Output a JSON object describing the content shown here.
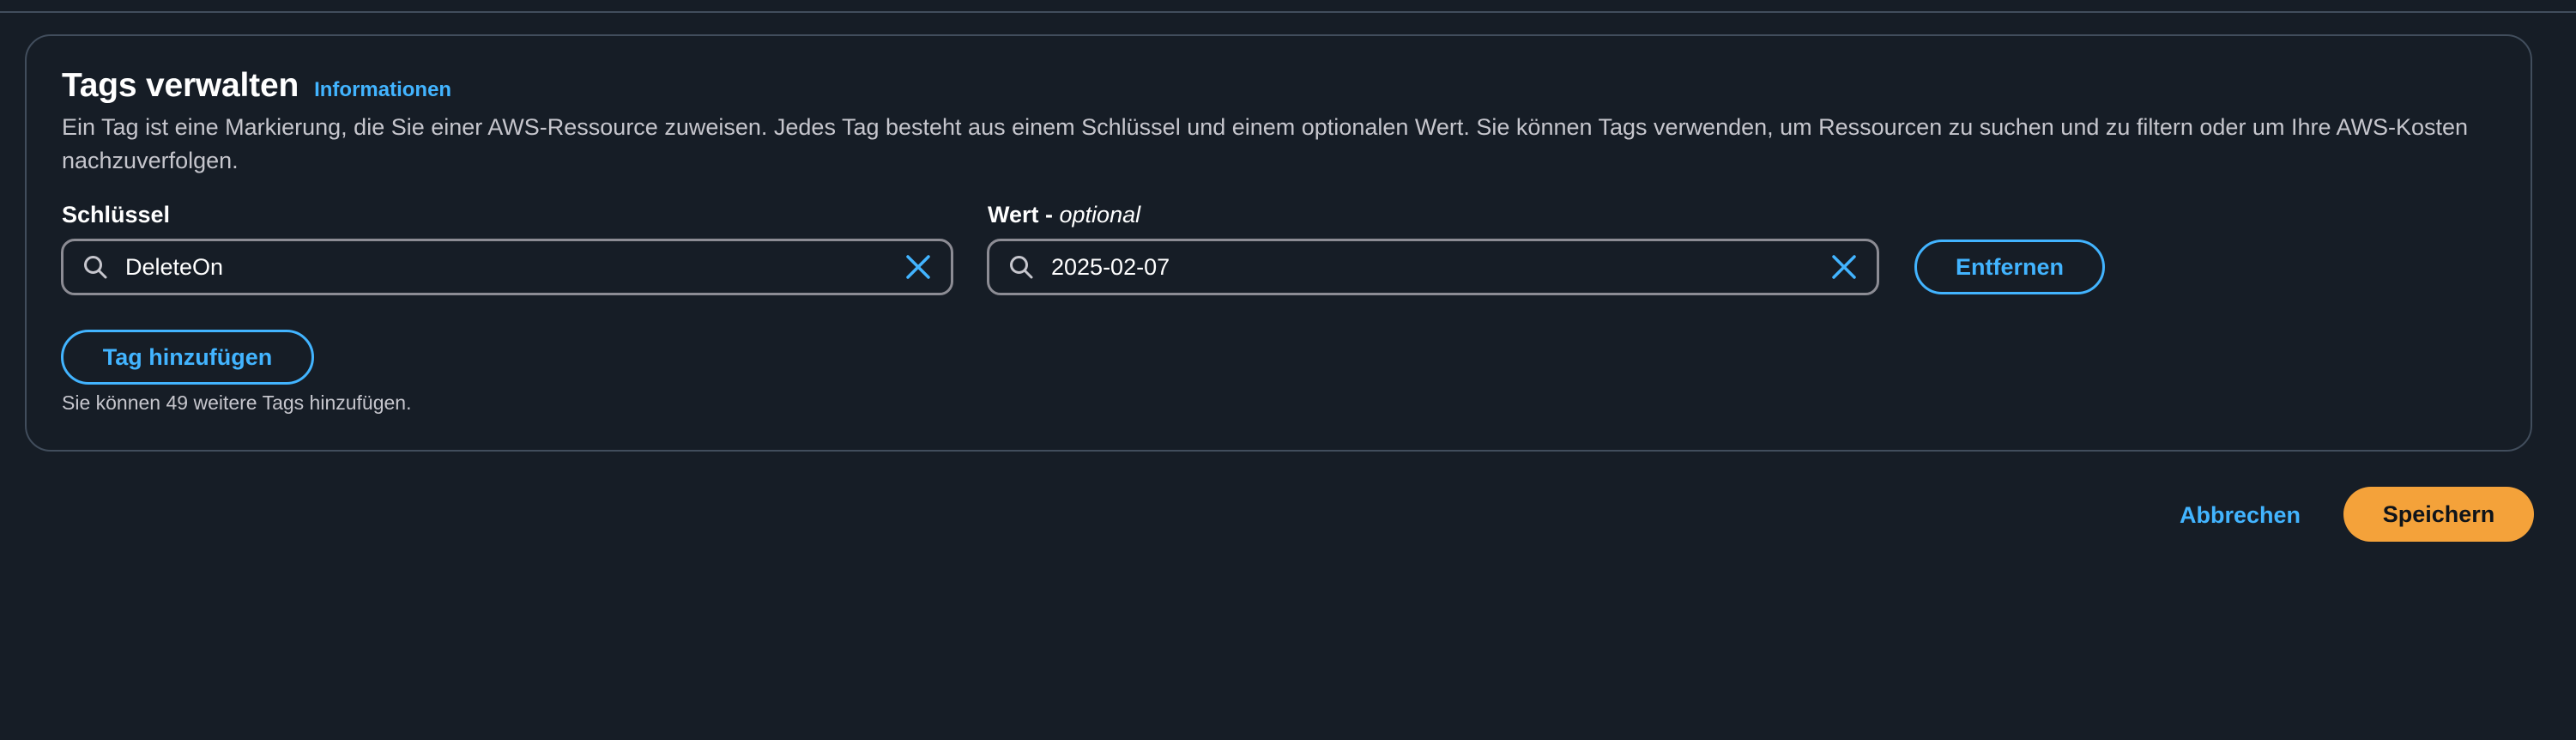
{
  "section": {
    "title": "Tags verwalten",
    "info_link": "Informationen",
    "description": "Ein Tag ist eine Markierung, die Sie einer AWS-Ressource zuweisen. Jedes Tag besteht aus einem Schlüssel und einem optionalen Wert. Sie können Tags verwenden, um Ressourcen zu suchen und zu filtern oder um Ihre AWS-Kosten nachzuverfolgen."
  },
  "tag_row": {
    "key_label": "Schlüssel",
    "value_label": "Wert - ",
    "value_label_optional": "optional",
    "key_value": "DeleteOn",
    "value_value": "2025-02-07",
    "remove_label": "Entfernen"
  },
  "add_tag_label": "Tag hinzufügen",
  "remaining_hint": "Sie können 49 weitere Tags hinzufügen.",
  "footer": {
    "cancel_label": "Abbrechen",
    "save_label": "Speichern"
  },
  "icons": {
    "search": "search-icon",
    "clear": "close-icon"
  },
  "colors": {
    "background": "#161d26",
    "border": "#414d5c",
    "link": "#42b4ff",
    "primary": "#f4a23a",
    "text_secondary": "#c6c6cd"
  }
}
